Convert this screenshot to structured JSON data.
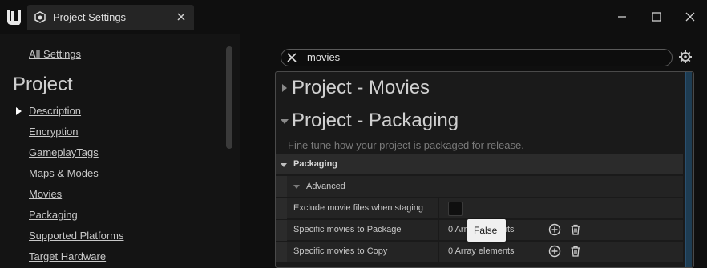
{
  "window": {
    "tab_title": "Project Settings",
    "icons": [
      "unreal-logo-icon",
      "settings-cube-icon",
      "close-icon",
      "minimize-icon",
      "maximize-icon",
      "window-close-icon"
    ]
  },
  "sidebar": {
    "all_settings": "All Settings",
    "section_title": "Project",
    "items": [
      {
        "label": "Description",
        "selected": true
      },
      {
        "label": "Encryption"
      },
      {
        "label": "GameplayTags"
      },
      {
        "label": "Maps & Modes"
      },
      {
        "label": "Movies"
      },
      {
        "label": "Packaging"
      },
      {
        "label": "Supported Platforms"
      },
      {
        "label": "Target Hardware"
      }
    ]
  },
  "search": {
    "value": "movies"
  },
  "panel": {
    "categories": [
      {
        "title": "Project - Movies",
        "expanded": false
      },
      {
        "title": "Project - Packaging",
        "expanded": true
      }
    ],
    "description": "Fine tune how your project is packaged for release.",
    "group": "Packaging",
    "subgroup": "Advanced",
    "properties": [
      {
        "name": "Exclude movie files when staging",
        "value": "",
        "type": "checkbox",
        "checked": false
      },
      {
        "name": "Specific movies to Package",
        "value": "0 Array elements",
        "type": "array"
      },
      {
        "name": "Specific movies to Copy",
        "value": "0 Array elements",
        "type": "array"
      }
    ]
  },
  "tooltip": {
    "text": "False"
  },
  "colors": {
    "background": "#0f0f0f",
    "panel": "#1a1a1a",
    "accent_scroll": "#1e3c52"
  }
}
